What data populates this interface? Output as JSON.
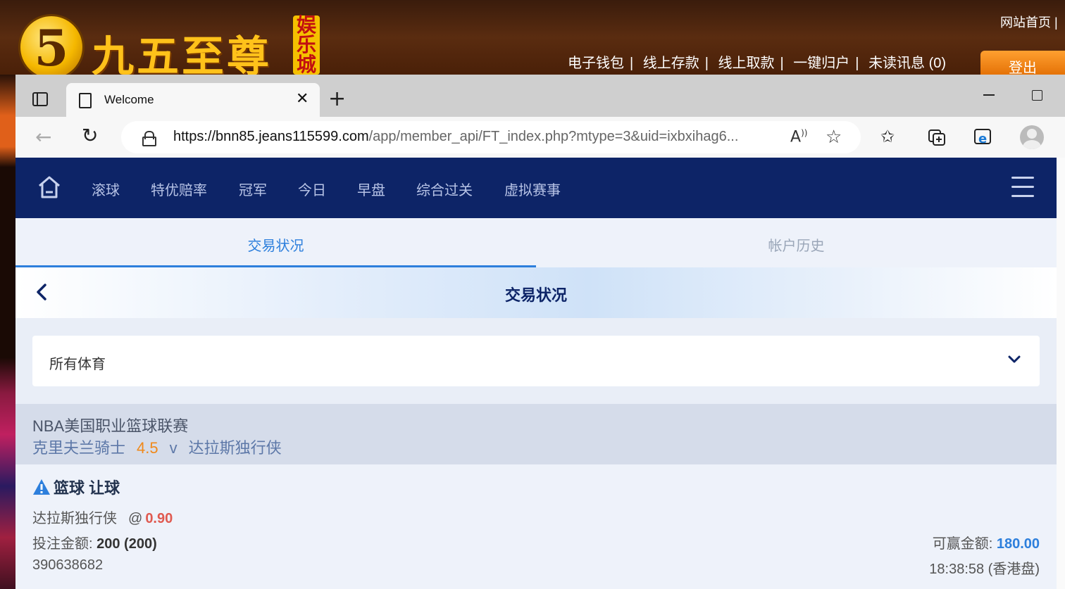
{
  "site": {
    "logo_digit": "5",
    "logo_text": "九五至尊",
    "logo_badge": "娱乐城",
    "home_link": "网站首页 |",
    "links": [
      "电子钱包",
      "线上存款",
      "线上取款",
      "一键归户",
      "未读讯息 (0)"
    ],
    "link_separator": "|",
    "login_label": "登出"
  },
  "browser": {
    "tab_title": "Welcome",
    "url_host": "https://bnn85.jeans115599.com",
    "url_path": "/app/member_api/FT_index.php?mtype=3&uid=ixbxihag6..."
  },
  "nav": {
    "items": [
      "滚球",
      "特优赔率",
      "冠军",
      "今日",
      "早盘",
      "综合过关",
      "虚拟赛事"
    ]
  },
  "subtabs": {
    "active": "交易状况",
    "inactive": "帐户历史"
  },
  "page_title": "交易状况",
  "filter": {
    "selected": "所有体育"
  },
  "league": {
    "name": "NBA美国职业篮球联赛",
    "home_team": "克里夫兰骑士",
    "handicap": "4.5",
    "vs": "v",
    "away_team": "达拉斯独行侠"
  },
  "bet": {
    "type": "篮球 让球",
    "pick_team": "达拉斯独行侠",
    "at_symbol": "@",
    "odds": "0.90",
    "stake_label": "投注金额:",
    "stake_value": "200 (200)",
    "win_label": "可赢金额:",
    "win_value": "180.00",
    "ticket_id": "390638682",
    "time": "18:38:58 (香港盘)"
  },
  "colors": {
    "nav_bg": "#0d2467",
    "accent_blue": "#2d7fdc",
    "odds_red": "#e05a50",
    "handicap_orange": "#f0891a"
  }
}
